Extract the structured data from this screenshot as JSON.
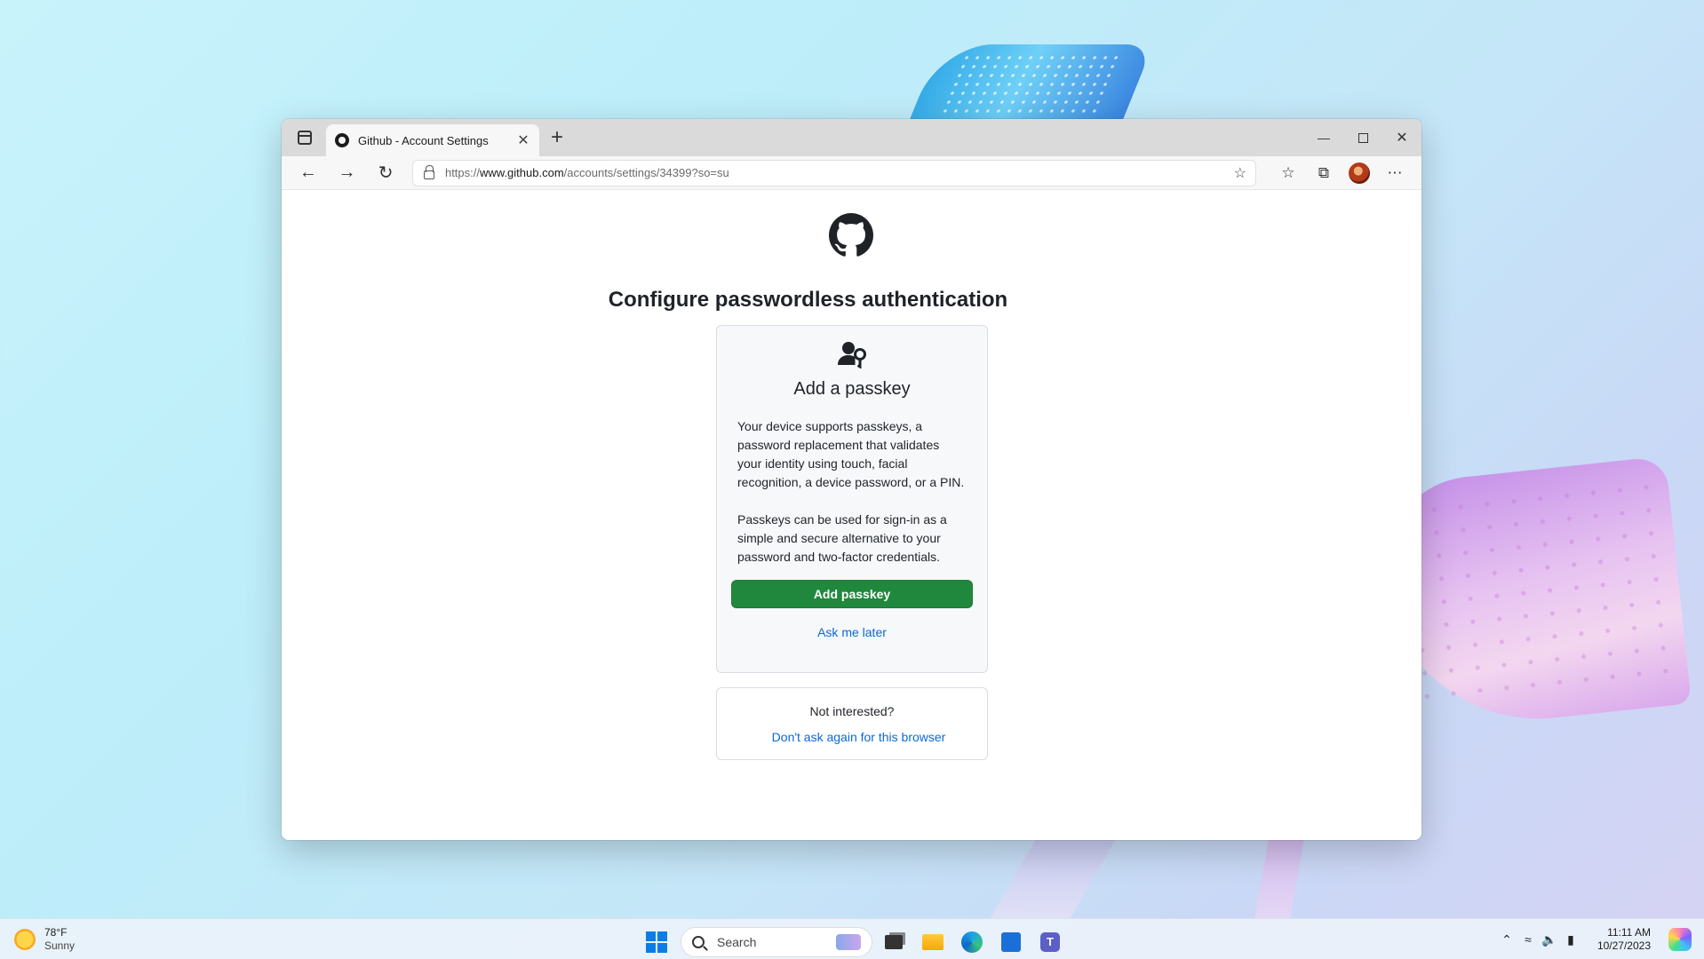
{
  "browser": {
    "tab_title": "Github - Account Settings",
    "tab_close": "✕",
    "new_tab": "+",
    "url_scheme": "https://",
    "url_host": "www.github.com",
    "url_path": "/accounts/settings/34399?so=su"
  },
  "page": {
    "title": "Configure passwordless authentication",
    "card": {
      "title": "Add a passkey",
      "paragraph1": "Your device supports passkeys, a password replacement that validates your identity using touch, facial recognition, a device password, or a PIN.",
      "paragraph2": "Passkeys can be used for sign-in as a simple and secure alternative to your password and two-factor credentials.",
      "primary_button": "Add passkey",
      "secondary_link": "Ask me later"
    },
    "optout": {
      "question": "Not interested?",
      "link": "Don't ask again for this browser"
    }
  },
  "taskbar": {
    "weather_temp": "78°F",
    "weather_cond": "Sunny",
    "search_label": "Search",
    "time": "11:11 AM",
    "date": "10/27/2023"
  },
  "colors": {
    "primary_button": "#1f883d",
    "link": "#0969da",
    "start_blue": "#0a7ee6"
  }
}
